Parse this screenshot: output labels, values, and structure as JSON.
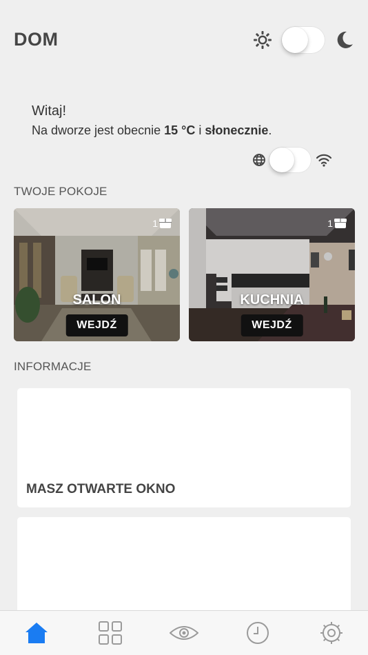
{
  "header": {
    "title": "DOM",
    "theme_toggle": {
      "left_icon": "sun-icon",
      "right_icon": "moon-icon",
      "on": false
    }
  },
  "greeting": {
    "hello": "Witaj!",
    "prefix": "Na dworze jest obecnie ",
    "temperature": "15 °C",
    "middle": " i ",
    "weather": "słonecznie",
    "suffix": "."
  },
  "network_toggle": {
    "left_icon": "globe-icon",
    "right_icon": "wifi-icon",
    "on": false
  },
  "rooms": {
    "label": "TWOJE POKOJE",
    "items": [
      {
        "name": "SALON",
        "count": "1",
        "button": "WEJDŹ"
      },
      {
        "name": "KUCHNIA",
        "count": "1",
        "button": "WEJDŹ"
      }
    ]
  },
  "info": {
    "label": "INFORMACJE",
    "cards": [
      {
        "title": "MASZ OTWARTE OKNO"
      },
      {
        "title": ""
      }
    ]
  },
  "tabbar": {
    "active_color": "#1a7cf2",
    "inactive_color": "#9a9a9a",
    "tabs": [
      "home-icon",
      "grid-icon",
      "eye-icon",
      "clock-icon",
      "settings-icon"
    ]
  }
}
